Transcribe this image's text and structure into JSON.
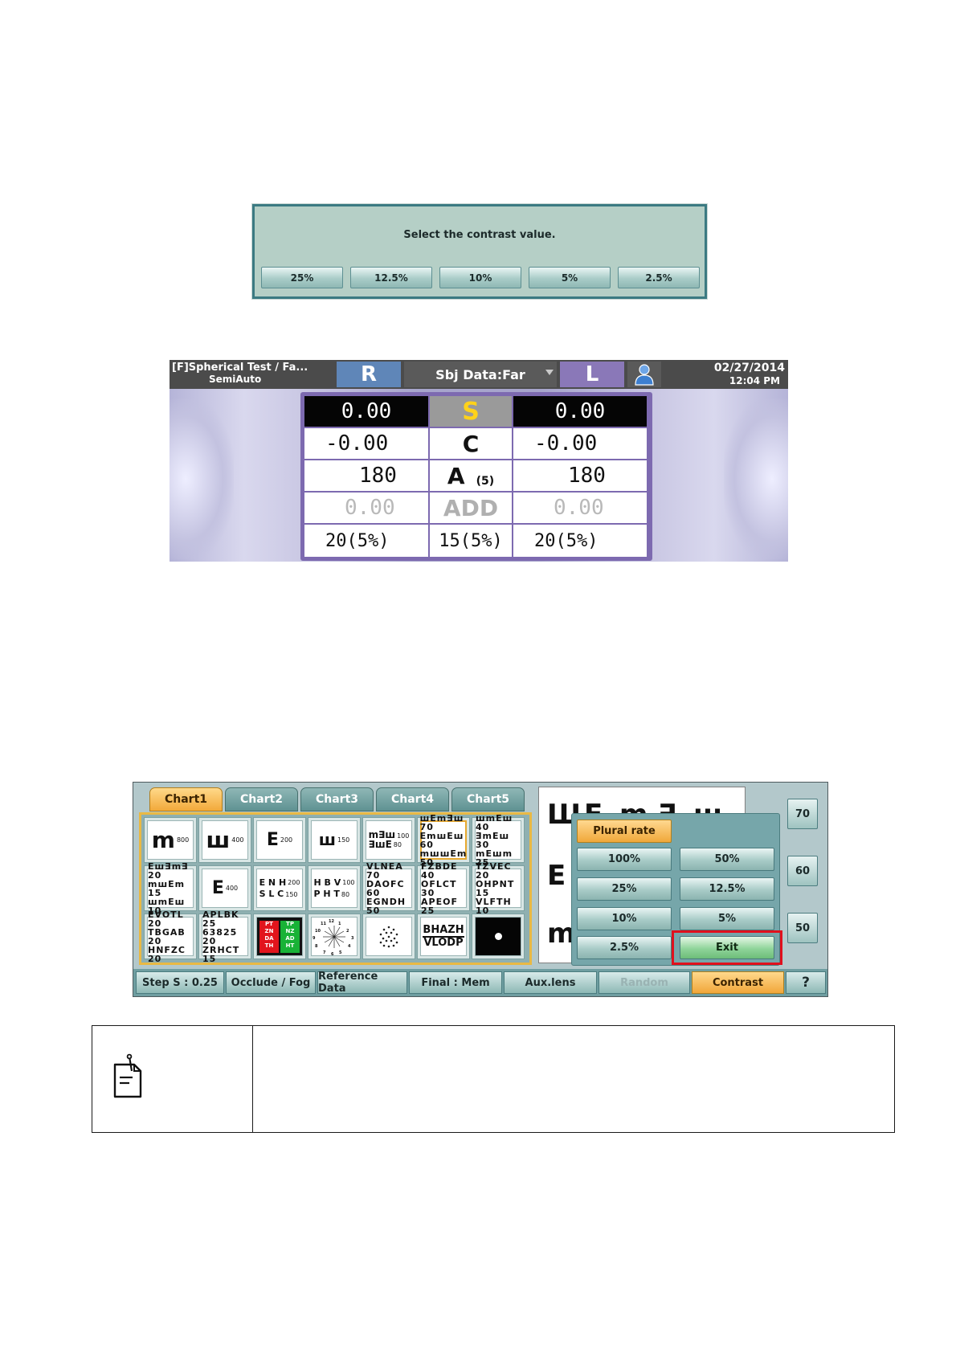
{
  "contrast_dialog": {
    "message": "Select the contrast value.",
    "buttons": [
      "25%",
      "12.5%",
      "10%",
      "5%",
      "2.5%"
    ]
  },
  "refraction_panel": {
    "title_line1": "[F]Spherical Test / Fa...",
    "title_line2": "SemiAuto",
    "right_label": "R",
    "mode_label": "Sbj Data:Far",
    "left_label": "L",
    "date": "02/27/2014",
    "time": "12:04 PM",
    "rows": [
      {
        "right": "0.00",
        "label": "S",
        "left": "0.00"
      },
      {
        "right": "-0.00",
        "label": "C",
        "left": "-0.00"
      },
      {
        "right": "180",
        "label": "A",
        "label_sub": "(5)",
        "left": "180"
      },
      {
        "right": "0.00",
        "label": "ADD",
        "left": "0.00"
      },
      {
        "right": "20(5%)",
        "label": "15(5%)",
        "left": "20(5%)"
      }
    ]
  },
  "chart_panel": {
    "tabs": [
      "Chart1",
      "Chart2",
      "Chart3",
      "Chart4",
      "Chart5"
    ],
    "active_tab": "Chart1",
    "charts": {
      "r1": [
        {
          "glyph": "m",
          "size": "800"
        },
        {
          "glyph": "ш",
          "size": "400"
        },
        {
          "glyph": "E",
          "size": "200"
        },
        {
          "glyph": "ш",
          "size": "150"
        },
        {
          "line1": "m∃ш",
          "s1": "100",
          "line2": "∃шE",
          "s2": "80"
        },
        {
          "lines": [
            "шEm∃ш 70",
            "EmшEш 60",
            "mшшEm 50"
          ]
        },
        {
          "lines": [
            "шmEш 40",
            "∃mEш 30",
            "mEшm 25"
          ]
        }
      ],
      "r2": [
        {
          "lines": [
            "Eш∃m∃ 20",
            "mшEm 15",
            "шmEш 10"
          ]
        },
        {
          "glyph": "E",
          "size": "400"
        },
        {
          "line1": "E N H",
          "s1": "200",
          "line2": "S L C",
          "s2": "150"
        },
        {
          "line1": "H B V",
          "s1": "100",
          "line2": "P H T",
          "s2": "80"
        },
        {
          "lines": [
            "VLNEA 70",
            "DAOFC 60",
            "EGNDH 50"
          ]
        },
        {
          "lines": [
            "FZBDE 40",
            "OFLCT 30",
            "APEOF 25"
          ]
        },
        {
          "lines": [
            "TZVEC 20",
            "OHPNT 15",
            "VLFTH 10"
          ]
        }
      ],
      "r3": [
        {
          "lines": [
            "EVOTL 20",
            "TBGAB 20",
            "HNFZC 20"
          ]
        },
        {
          "lines": [
            "APLBK 25",
            "63825 20",
            "ZRHCT 15"
          ]
        },
        {
          "red_green": [
            "PT",
            "ZN",
            "DA",
            "TH",
            "TP",
            "NZ",
            "AD",
            "HT"
          ]
        },
        {
          "clock": [
            "11",
            "12",
            "1",
            "10",
            "2",
            "9",
            "3",
            "8",
            "4",
            "7",
            "6",
            "5"
          ]
        },
        {
          "dots": true
        },
        {
          "line1": "BHAZH",
          "line2": "VLODP"
        },
        {
          "dot": true
        }
      ]
    },
    "plural_rate": {
      "header": "Plural rate",
      "buttons": [
        "100%",
        "50%",
        "25%",
        "12.5%",
        "10%",
        "5%",
        "2.5%",
        "Exit"
      ]
    },
    "side_buttons": [
      "70",
      "60",
      "50"
    ],
    "bottom_bar": [
      "Step S : 0.25",
      "Occlude / Fog",
      "Reference Data",
      "Final : Mem",
      "Aux.lens",
      "Random",
      "Contrast",
      "?"
    ],
    "active_bottom": "Contrast"
  }
}
